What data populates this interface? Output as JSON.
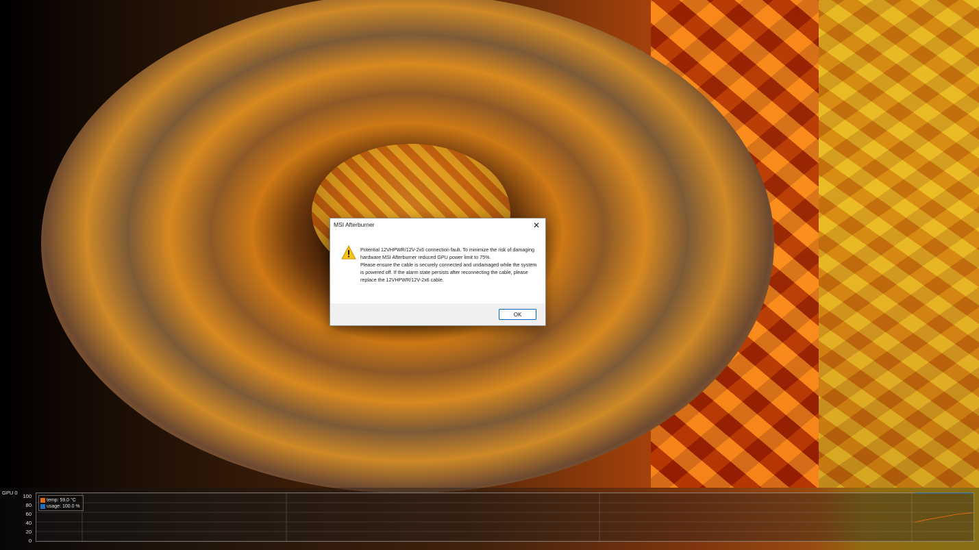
{
  "dialog": {
    "title": "MSI Afterburner",
    "close_icon": "close-icon",
    "warning_icon": "warning-icon",
    "message_line1": "Potential 12VHPWR/12V-2x6 connection fault. To minimize the risk of damaging hardware MSI Afterburner reduced GPU power limit to 75%.",
    "message_line2": "Please ensure the cable is securely connected and undamaged while the system is powered off. If the alarm state persists after reconnecting the cable, please replace the 12VHPWR/12V-2x6 cable.",
    "ok_label": "OK"
  },
  "monitor": {
    "gpu_label": "GPU 0",
    "y_ticks": [
      "100",
      "80",
      "60",
      "40",
      "20",
      "0"
    ],
    "legend": [
      {
        "label": "temp: 59.0 °C",
        "color": "#e06a10"
      },
      {
        "label": "usage: 100.0 %",
        "color": "#1f6fc0"
      }
    ]
  },
  "chart_data": {
    "type": "line",
    "ylim": [
      0,
      100
    ],
    "series": [
      {
        "name": "temp",
        "values": [
          39,
          42,
          44,
          46,
          48,
          50,
          52,
          54,
          56,
          57,
          58,
          59
        ]
      },
      {
        "name": "usage",
        "values": [
          100,
          100,
          100,
          100,
          100,
          100,
          100,
          100,
          100,
          100,
          100,
          100
        ]
      }
    ]
  }
}
